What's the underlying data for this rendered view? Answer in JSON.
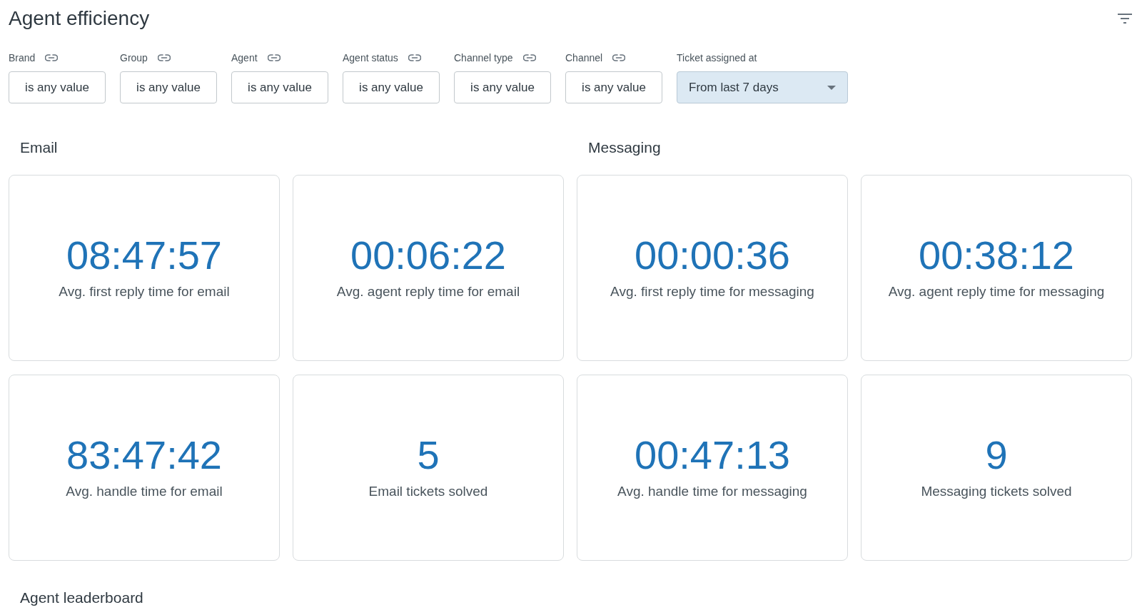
{
  "title": "Agent efficiency",
  "filters": [
    {
      "label": "Brand",
      "linked": true,
      "kind": "chip",
      "value": "is any value"
    },
    {
      "label": "Group",
      "linked": true,
      "kind": "chip",
      "value": "is any value"
    },
    {
      "label": "Agent",
      "linked": true,
      "kind": "chip",
      "value": "is any value"
    },
    {
      "label": "Agent status",
      "linked": true,
      "kind": "chip",
      "value": "is any value"
    },
    {
      "label": "Channel type",
      "linked": true,
      "kind": "chip",
      "value": "is any value"
    },
    {
      "label": "Channel",
      "linked": true,
      "kind": "chip",
      "value": "is any value"
    },
    {
      "label": "Ticket assigned at",
      "linked": false,
      "kind": "dropdown",
      "value": "From last 7 days"
    }
  ],
  "sections": [
    {
      "title": "Email",
      "tiles": [
        {
          "value": "08:47:57",
          "label": "Avg. first reply time for email"
        },
        {
          "value": "00:06:22",
          "label": "Avg. agent reply time for email"
        },
        {
          "value": "83:47:42",
          "label": "Avg. handle time for email"
        },
        {
          "value": "5",
          "label": "Email tickets solved"
        }
      ]
    },
    {
      "title": "Messaging",
      "tiles": [
        {
          "value": "00:00:36",
          "label": "Avg. first reply time for messaging"
        },
        {
          "value": "00:38:12",
          "label": "Avg. agent reply time for messaging"
        },
        {
          "value": "00:47:13",
          "label": "Avg. handle time for messaging"
        },
        {
          "value": "9",
          "label": "Messaging tickets solved"
        }
      ]
    }
  ],
  "footer_heading": "Agent leaderboard"
}
